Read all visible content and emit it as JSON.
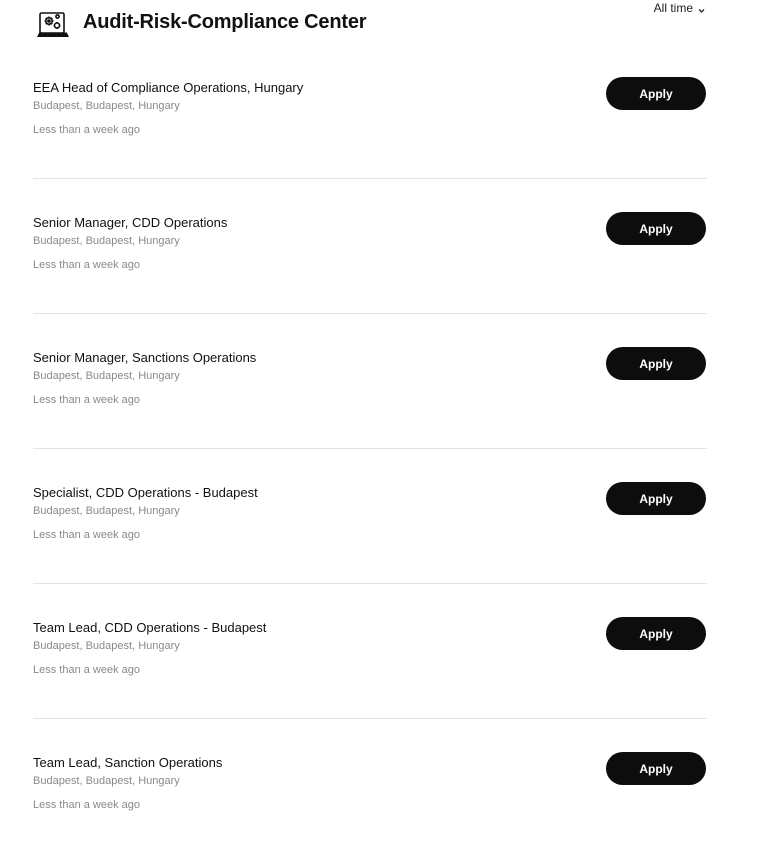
{
  "header": {
    "title": "Audit-Risk-Compliance Center",
    "icon": "laptop-gears-icon",
    "filter_label": "All time",
    "filter_icon": "chevron-down-icon"
  },
  "jobs": [
    {
      "title": "EEA Head of Compliance Operations, Hungary",
      "location": "Budapest, Budapest, Hungary",
      "posted": "Less than a week ago",
      "apply_label": "Apply"
    },
    {
      "title": "Senior Manager, CDD Operations",
      "location": "Budapest, Budapest, Hungary",
      "posted": "Less than a week ago",
      "apply_label": "Apply"
    },
    {
      "title": "Senior Manager, Sanctions Operations",
      "location": "Budapest, Budapest, Hungary",
      "posted": "Less than a week ago",
      "apply_label": "Apply"
    },
    {
      "title": "Specialist, CDD Operations - Budapest",
      "location": "Budapest, Budapest, Hungary",
      "posted": "Less than a week ago",
      "apply_label": "Apply"
    },
    {
      "title": "Team Lead, CDD Operations - Budapest",
      "location": "Budapest, Budapest, Hungary",
      "posted": "Less than a week ago",
      "apply_label": "Apply"
    },
    {
      "title": "Team Lead, Sanction Operations",
      "location": "Budapest, Budapest, Hungary",
      "posted": "Less than a week ago",
      "apply_label": "Apply"
    }
  ],
  "colors": {
    "button_bg": "#0d0d0d",
    "button_text": "#ffffff",
    "muted_text": "#8a8a8a",
    "divider": "#e3e3e3"
  }
}
